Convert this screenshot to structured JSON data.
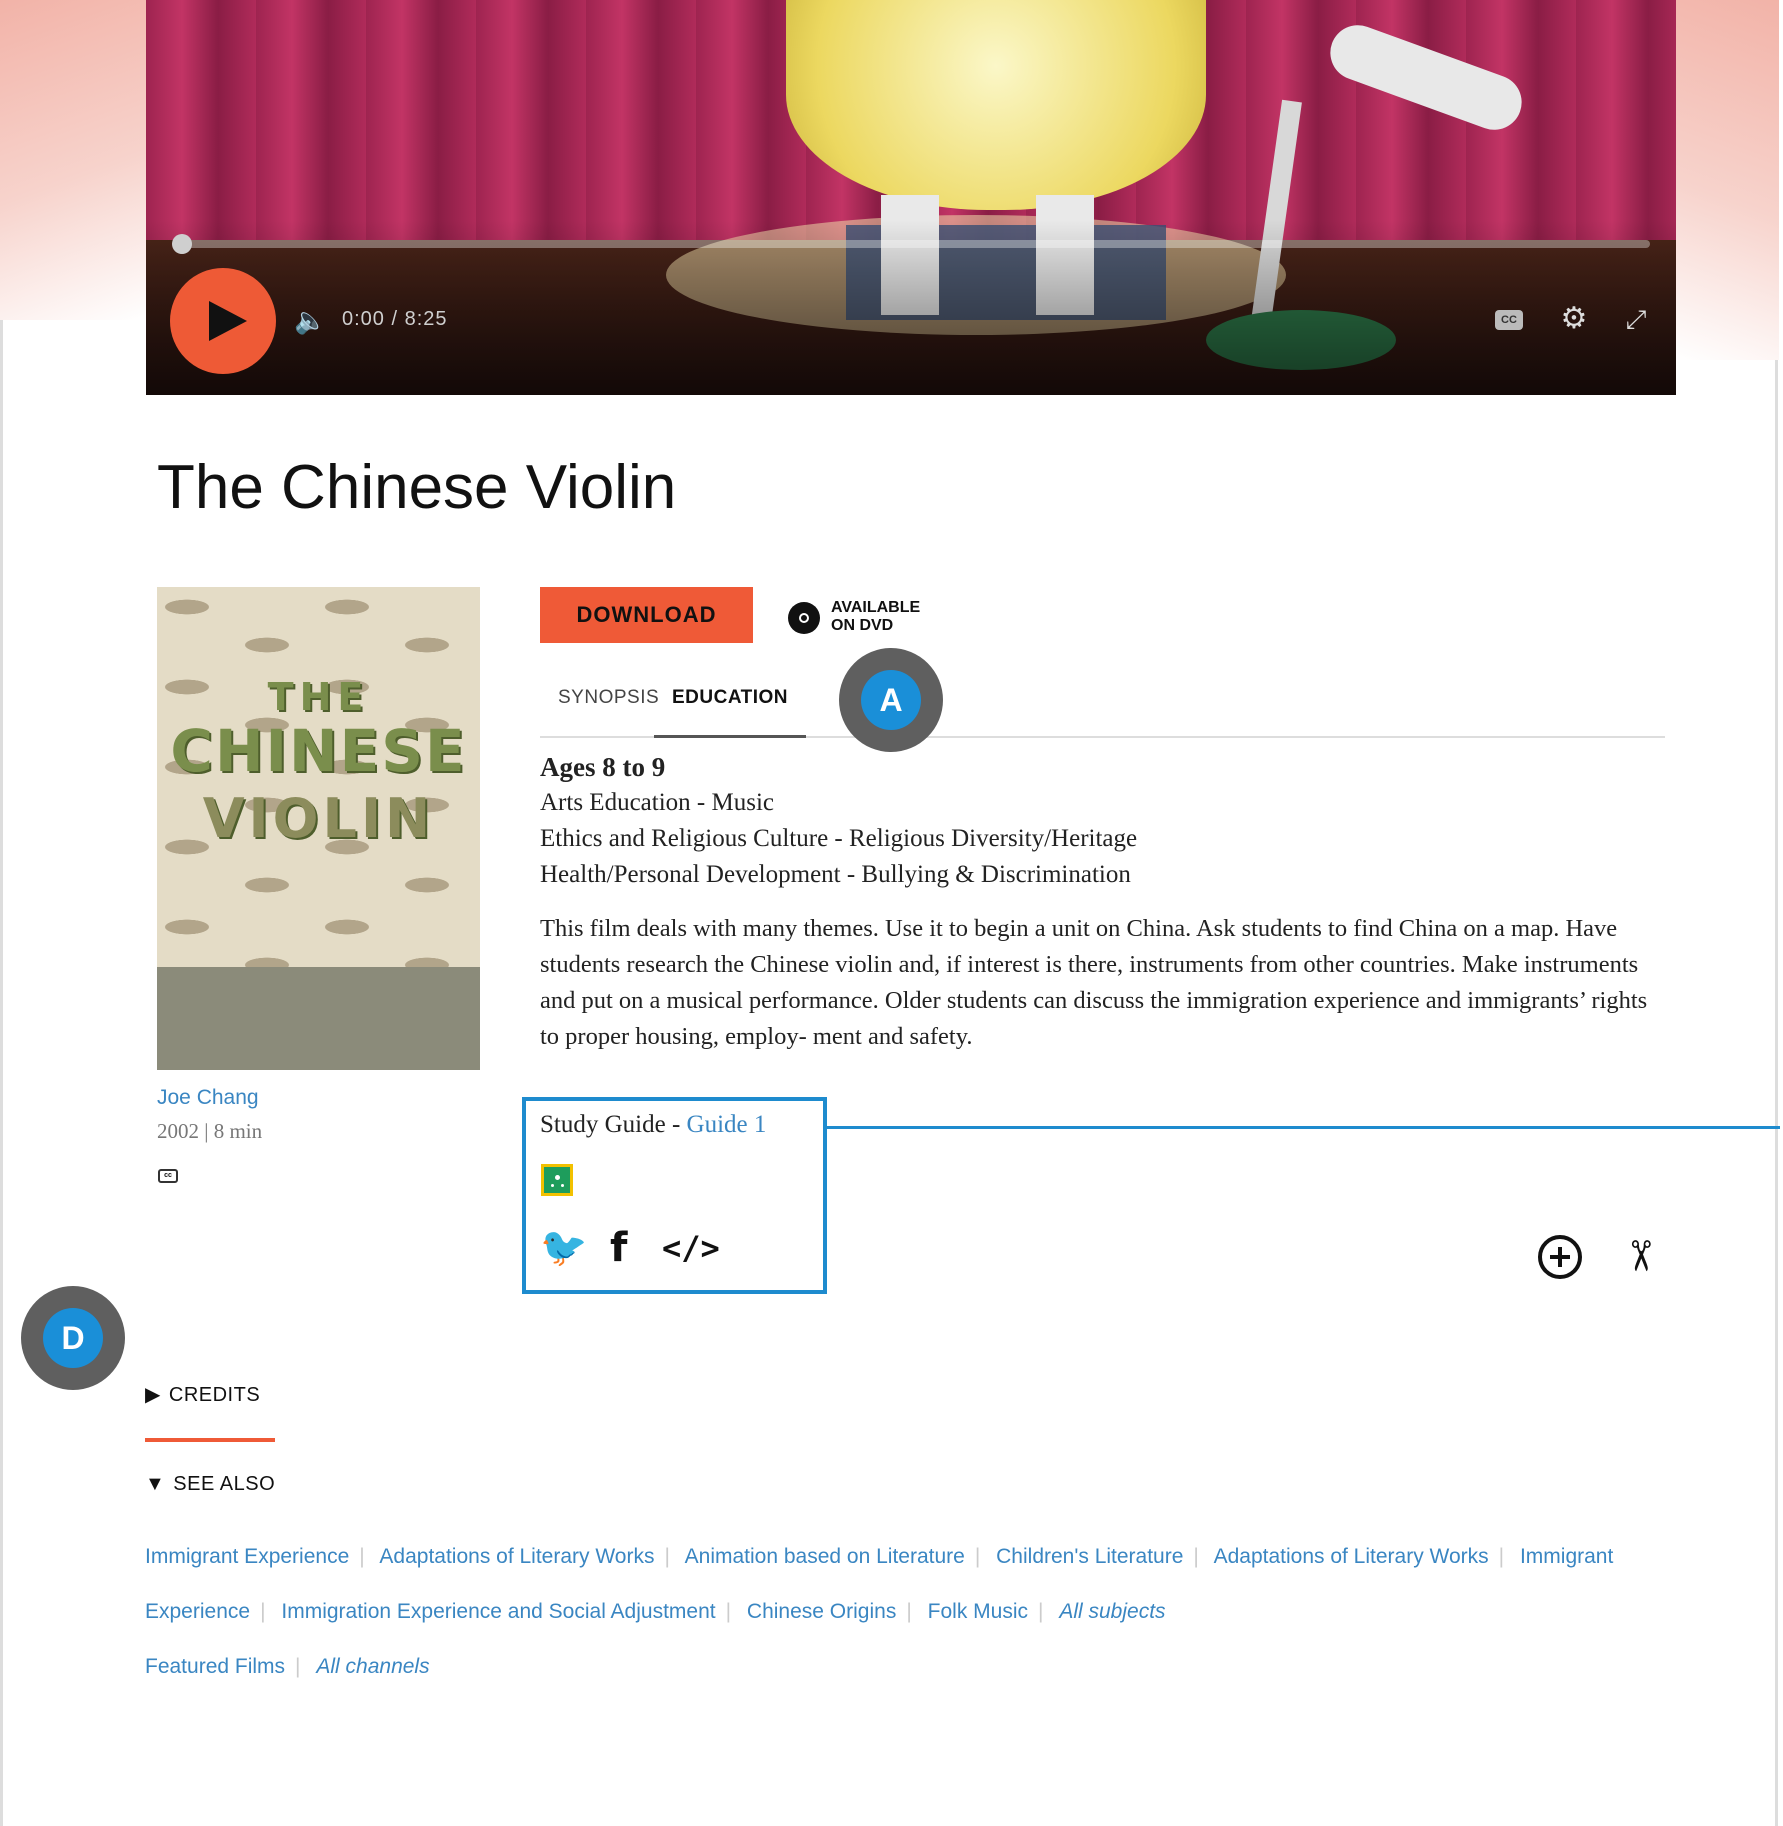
{
  "player": {
    "time": "0:00 / 8:25",
    "cc_label": "CC",
    "play_icon": "play-icon",
    "volume_icon": "volume-icon",
    "settings_icon": "gear-icon",
    "fullscreen_icon": "fullscreen-icon",
    "progress": 0
  },
  "film": {
    "title": "The Chinese Violin",
    "poster_text": [
      "THE",
      "CHINESE",
      "VIOLIN"
    ],
    "director": "Joe Chang",
    "meta": "2002 | 8 min"
  },
  "actions": {
    "download_label": "DOWNLOAD",
    "dvd_label_line1": "AVAILABLE",
    "dvd_label_line2": "ON DVD"
  },
  "tabs": [
    {
      "label": "SYNOPSIS",
      "active": false
    },
    {
      "label": "EDUCATION",
      "active": true
    }
  ],
  "education": {
    "ages": "Ages 8 to 9",
    "subjects": [
      "Arts Education - Music",
      "Ethics and Religious Culture - Religious Diversity/Heritage",
      "Health/Personal Development - Bullying & Discrimination"
    ],
    "description": "This film deals with many themes. Use it to begin a unit on China. Ask students to find China on a map. Have students research the Chinese violin and, if interest is there, instruments from other countries. Make instruments and put on a musical performance. Older students can discuss the immigration experience and immigrants’ rights to proper housing, employ- ment and safety.",
    "study_guide_label": "Study Guide - ",
    "study_guide_link": "Guide 1"
  },
  "share": {
    "twitter": "🐦",
    "facebook": "f",
    "embed": "</>"
  },
  "annotations": {
    "a": "A",
    "d": "D"
  },
  "sections": {
    "credits": "CREDITS",
    "see_also": "SEE ALSO"
  },
  "see_also_links": {
    "row1": [
      "Immigrant Experience",
      "Adaptations of Literary Works",
      "Animation based on Literature",
      "Children's Literature",
      "Adaptations of Literary Works",
      "Immigrant"
    ],
    "row2": [
      "Experience",
      "Immigration Experience and Social Adjustment",
      "Chinese Origins",
      "Folk Music",
      "All subjects"
    ],
    "row3": [
      "Featured Films",
      "All channels"
    ]
  },
  "colors": {
    "accent": "#ef5a37",
    "link": "#3a86c2",
    "callout": "#1e8bce"
  }
}
